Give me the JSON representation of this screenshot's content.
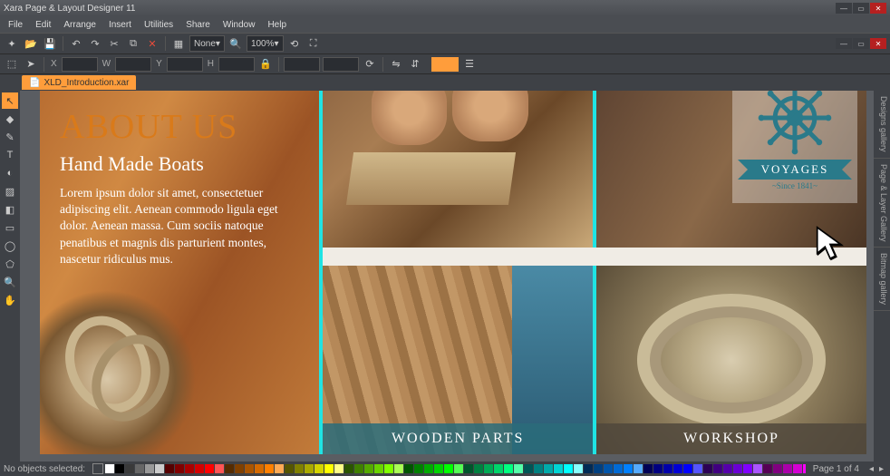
{
  "app": {
    "title": "Xara Page & Layout Designer 11"
  },
  "menu": [
    "File",
    "Edit",
    "Arrange",
    "Insert",
    "Utilities",
    "Share",
    "Window",
    "Help"
  ],
  "toolbar": {
    "style_dropdown": "None",
    "zoom": "100%"
  },
  "coords": {
    "X": "X",
    "Y": "Y",
    "W": "W",
    "H": "H"
  },
  "document_tab": "XLD_Introduction.xar",
  "right_panels": [
    "Designs gallery",
    "Page & Layer Gallery",
    "Bitmap gallery"
  ],
  "page": {
    "heading": "ABOUT US",
    "subheading": "Hand Made Boats",
    "body": "Lorem ipsum dolor sit amet, consectetuer adipiscing elit. Aenean commodo ligula eget dolor. Aenean massa. Cum sociis natoque penatibus et magnis dis parturient montes, nascetur ridiculus mus.",
    "logo_text": "VOYAGES",
    "logo_since": "~Since 1841~",
    "caption_deck": "WOODEN PARTS",
    "caption_rope": "WORKSHOP"
  },
  "status": {
    "selection": "No objects selected:",
    "page_info": "Page 1 of 4"
  },
  "swatches": [
    "#ffffff",
    "#000000",
    "#3a3a3a",
    "#666666",
    "#999999",
    "#cccccc",
    "#550000",
    "#800000",
    "#aa0000",
    "#d40000",
    "#ff0000",
    "#ff5555",
    "#552b00",
    "#804000",
    "#aa5500",
    "#d46a00",
    "#ff8000",
    "#ffaa55",
    "#555500",
    "#808000",
    "#aaaa00",
    "#d4d400",
    "#ffff00",
    "#ffff88",
    "#2b5500",
    "#408000",
    "#55aa00",
    "#6ad400",
    "#80ff00",
    "#aaff55",
    "#005500",
    "#008000",
    "#00aa00",
    "#00d400",
    "#00ff00",
    "#55ff55",
    "#00552b",
    "#008040",
    "#00aa55",
    "#00d46a",
    "#00ff80",
    "#55ffaa",
    "#005555",
    "#008080",
    "#00aaaa",
    "#00d4d4",
    "#00ffff",
    "#88ffff",
    "#002b55",
    "#004080",
    "#0055aa",
    "#006ad4",
    "#0080ff",
    "#55aaff",
    "#000055",
    "#000080",
    "#0000aa",
    "#0000d4",
    "#0000ff",
    "#5555ff",
    "#2b0055",
    "#400080",
    "#5500aa",
    "#6a00d4",
    "#8000ff",
    "#aa55ff",
    "#550055",
    "#800080",
    "#aa00aa",
    "#d400d4",
    "#ff00ff",
    "#ff55ff",
    "#55002b",
    "#800040",
    "#aa0055",
    "#d4006a",
    "#ff0080",
    "#ff55aa"
  ]
}
